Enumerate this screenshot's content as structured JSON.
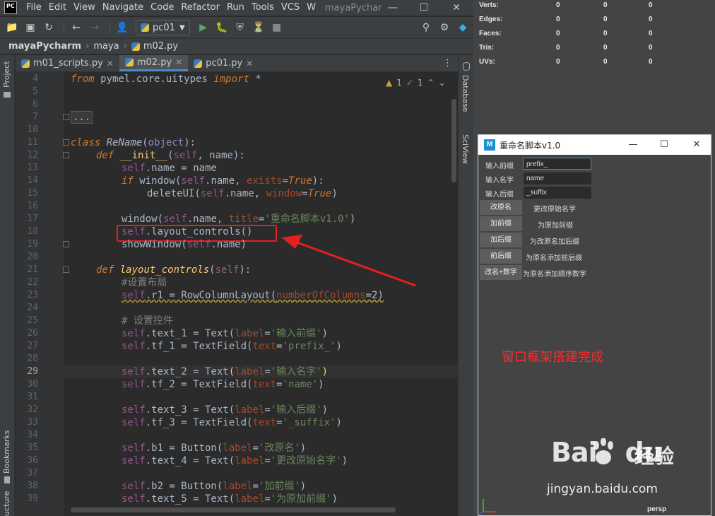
{
  "ide": {
    "logo_text": "PC",
    "menu": [
      "File",
      "Edit",
      "View",
      "Navigate",
      "Code",
      "Refactor",
      "Run",
      "Tools",
      "VCS",
      "W"
    ],
    "window_title": "mayaPychar",
    "run_config": "pc01",
    "breadcrumb": [
      "mayaPycharm",
      "maya",
      "m02.py"
    ],
    "tabs": [
      {
        "label": "m01_scripts.py",
        "active": false
      },
      {
        "label": "m02.py",
        "active": true
      },
      {
        "label": "pc01.py",
        "active": false
      }
    ],
    "left_strip": {
      "project": "Project",
      "bookmarks": "Bookmarks",
      "structure": "ucture"
    },
    "right_strip": {
      "database": "Database",
      "sciview": "SciView"
    },
    "inspections": {
      "warnings": "1",
      "weak_warnings": "1"
    },
    "line_numbers": [
      "4",
      "5",
      "6",
      "7",
      "10",
      "11",
      "12",
      "13",
      "14",
      "15",
      "16",
      "17",
      "18",
      "19",
      "20",
      "21",
      "22",
      "23",
      "24",
      "25",
      "26",
      "27",
      "28",
      "29",
      "30",
      "31",
      "32",
      "33",
      "34",
      "35",
      "36",
      "37",
      "38",
      "39"
    ],
    "current_line": "29",
    "code": {
      "l4": [
        "from",
        " pymel.core.uitypes ",
        "import",
        " *"
      ],
      "l7": "...",
      "l11": [
        "class",
        " ",
        "ReName",
        "(",
        "object",
        "):"
      ],
      "l12": [
        "def",
        " ",
        "__init__",
        "(",
        "self",
        ", name):"
      ],
      "l13": [
        "self",
        ".name = name"
      ],
      "l14": [
        "if",
        " window(",
        "self",
        ".name, ",
        "exists",
        "=",
        "True",
        "):"
      ],
      "l15": [
        "deleteUI(",
        "self",
        ".name, ",
        "window",
        "=",
        "True",
        ")"
      ],
      "l17": [
        "window(",
        "self",
        ".name, ",
        "title",
        "=",
        "'重命名脚本v1.0'",
        ")"
      ],
      "l18": [
        "self",
        ".layout_controls()"
      ],
      "l19": [
        "showWindow(",
        "self",
        ".name)"
      ],
      "l21": [
        "def",
        " ",
        "layout_controls",
        "(",
        "self",
        "):"
      ],
      "l22": "#设置布局",
      "l23": [
        "self",
        ".r1 = RowColumnLayout(",
        "numberOfColumns",
        "=2)"
      ],
      "l25": "# 设置控件",
      "l26": [
        "self",
        ".text_1 = Text(",
        "label",
        "=",
        "'输入前缀'",
        ")"
      ],
      "l27": [
        "self",
        ".tf_1 = TextField(",
        "text",
        "=",
        "'prefix_'",
        ")"
      ],
      "l29": [
        "self",
        ".text_2 = Text",
        "(",
        "label",
        "=",
        "'输入名字'",
        ")"
      ],
      "l30": [
        "self",
        ".tf_2 = TextField(",
        "text",
        "=",
        "'name'",
        ")"
      ],
      "l32": [
        "self",
        ".text_3 = Text(",
        "label",
        "=",
        "'输入后缀'",
        ")"
      ],
      "l33": [
        "self",
        ".tf_3 = TextField(",
        "text",
        "=",
        "'_suffix'",
        ")"
      ],
      "l35": [
        "self",
        ".b1 = Button(",
        "label",
        "=",
        "'改原名'",
        ")"
      ],
      "l36": [
        "self",
        ".text_4 = Text(",
        "label",
        "=",
        "'更改原始名字'",
        ")"
      ],
      "l38": [
        "self",
        ".b2 = Button(",
        "label",
        "=",
        "'加前缀'",
        ")"
      ],
      "l39": [
        "self",
        ".text_5 = Text(",
        "label",
        "=",
        "'为原加前缀'",
        ")"
      ]
    }
  },
  "maya": {
    "hud": {
      "rows": [
        {
          "label": "Verts:",
          "values": [
            "0",
            "0",
            "0"
          ]
        },
        {
          "label": "Edges:",
          "values": [
            "0",
            "0",
            "0"
          ]
        },
        {
          "label": "Faces:",
          "values": [
            "0",
            "0",
            "0"
          ]
        },
        {
          "label": "Tris:",
          "values": [
            "0",
            "0",
            "0"
          ]
        },
        {
          "label": "UVs:",
          "values": [
            "0",
            "0",
            "0"
          ]
        }
      ]
    },
    "dialog": {
      "title": "重命名脚本v1.0",
      "fields": [
        {
          "label": "输入前缀",
          "value": "prefix_"
        },
        {
          "label": "输入名字",
          "value": "name"
        },
        {
          "label": "输入后缀",
          "value": "_suffix"
        }
      ],
      "buttons": [
        {
          "label": "改原名",
          "desc": "更改原始名字"
        },
        {
          "label": "加前缀",
          "desc": "为原加前缀"
        },
        {
          "label": "加后缀",
          "desc": "为改原名加后缀"
        },
        {
          "label": "前后缀",
          "desc": "为原名添加前后缀"
        },
        {
          "label": "改名+数字",
          "desc": "为原名添加顺序数字"
        }
      ],
      "note": "窗口框架搭建完成"
    },
    "viewport_label": "persp"
  },
  "watermark": {
    "brand": "Bai",
    "brand_suffix": "du",
    "cn": "经验",
    "url": "jingyan.baidu.com"
  },
  "colors": {
    "annotation_red": "#e42020",
    "note_red": "#ff2a2a",
    "accent_blue": "#4a88c7"
  }
}
